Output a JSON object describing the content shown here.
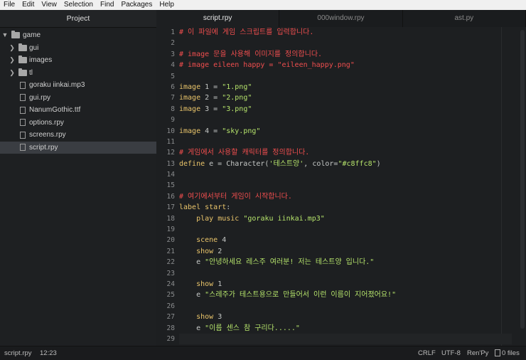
{
  "menubar": {
    "items": [
      "File",
      "Edit",
      "View",
      "Selection",
      "Find",
      "Packages",
      "Help"
    ]
  },
  "sidebar": {
    "title": "Project",
    "root": "game",
    "folders": [
      "gui",
      "images",
      "tl"
    ],
    "files": [
      "goraku iinkai.mp3",
      "gui.rpy",
      "NanumGothic.ttf",
      "options.rpy",
      "screens.rpy",
      "script.rpy"
    ],
    "selected": "script.rpy"
  },
  "tabs": [
    "script.rpy",
    "000window.rpy",
    "ast.py"
  ],
  "active_tab": "script.rpy",
  "editor": {
    "line_numbers": [
      "1",
      "2",
      "3",
      "4",
      "5",
      "6",
      "7",
      "8",
      "9",
      "10",
      "11",
      "12",
      "13",
      "14",
      "15",
      "16",
      "17",
      "18",
      "19",
      "20",
      "21",
      "22",
      "23",
      "24",
      "25",
      "26",
      "27",
      "28",
      "29"
    ],
    "lines": [
      "# 이 파일에 게임 스크립트를 입력합니다.",
      "",
      "# image 문을 사용해 이미지를 정의합니다.",
      "# image eileen happy = \"eileen_happy.png\"",
      "",
      "image 1 = \"1.png\"",
      "image 2 = \"2.png\"",
      "image 3 = \"3.png\"",
      "",
      "image 4 = \"sky.png\"",
      "",
      "# 게임에서 사용할 캐릭터를 정의합니다.",
      "define e = Character('테스트양', color=\"#c8ffc8\")",
      "",
      "",
      "# 여기에서부터 게임이 시작합니다.",
      "label start:",
      "    play music \"goraku iinkai.mp3\"",
      "",
      "    scene 4",
      "    show 2",
      "    e \"안녕하세요 레스주 여러분! 저는 테스트양 입니다.\"",
      "",
      "    show 1",
      "    e \"스레주가 테스트용으로 만들어서 이런 이름이 지어졌어요!\"",
      "",
      "    show 3",
      "    e \"이름 센스 참 구리다.....\"",
      ""
    ],
    "current_line": "29"
  },
  "status": {
    "file": "script.rpy",
    "cursor": "12:23",
    "line_ending": "CRLF",
    "encoding": "UTF-8",
    "grammar": "Ren'Py",
    "files_count": "0 files"
  },
  "colors": {
    "comment": "#ef4e4e",
    "keyword": "#e9c46a",
    "string": "#b5e36b",
    "text": "#c5c8c6"
  }
}
